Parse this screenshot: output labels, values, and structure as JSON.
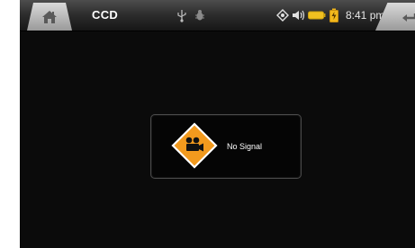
{
  "header": {
    "title": "CCD",
    "time": "8:41 pm",
    "icons": [
      "home-icon",
      "usb-icon",
      "bug-icon",
      "brightness-icon",
      "volume-icon",
      "battery-icon",
      "battery-charge-icon",
      "back-icon"
    ]
  },
  "dialog": {
    "message": "No Signal",
    "icon": "camera-warning-icon"
  },
  "colors": {
    "background": "#0b0b0b",
    "accent": "#f29a1e"
  }
}
